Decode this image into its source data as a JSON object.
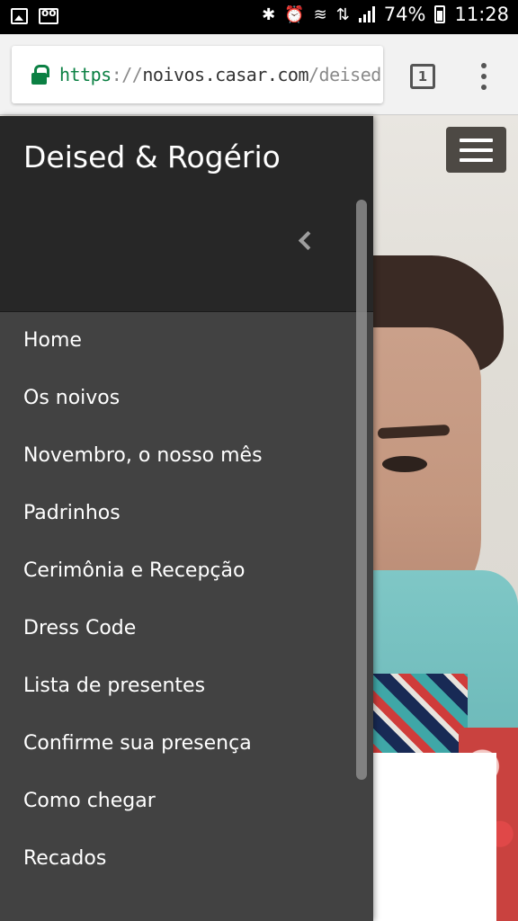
{
  "status_bar": {
    "battery": "74%",
    "time": "11:28",
    "icons": [
      "image-icon",
      "voicemail-icon",
      "bluetooth-mute-icon",
      "alarm-icon",
      "wifi-icon",
      "data-icon",
      "signal-icon",
      "battery-icon"
    ]
  },
  "browser": {
    "url_scheme": "https",
    "url_separator": "://",
    "url_host": "noivos.casar.com",
    "url_path": "/deised-",
    "tab_count": "1",
    "colors": {
      "secure": "#0b8043",
      "toolbar": "#f2f2f2"
    }
  },
  "site": {
    "title": "Deised & Rogério",
    "menu_items": [
      "Home",
      "Os noivos",
      "Novembro, o nosso mês",
      "Padrinhos",
      "Cerimônia e Recepção",
      "Dress Code",
      "Lista de presentes",
      "Confirme sua presença",
      "Como chegar",
      "Recados"
    ],
    "colors": {
      "drawer": "#424242",
      "drawer_header": "#272727",
      "hamburger": "#4d4944"
    }
  }
}
